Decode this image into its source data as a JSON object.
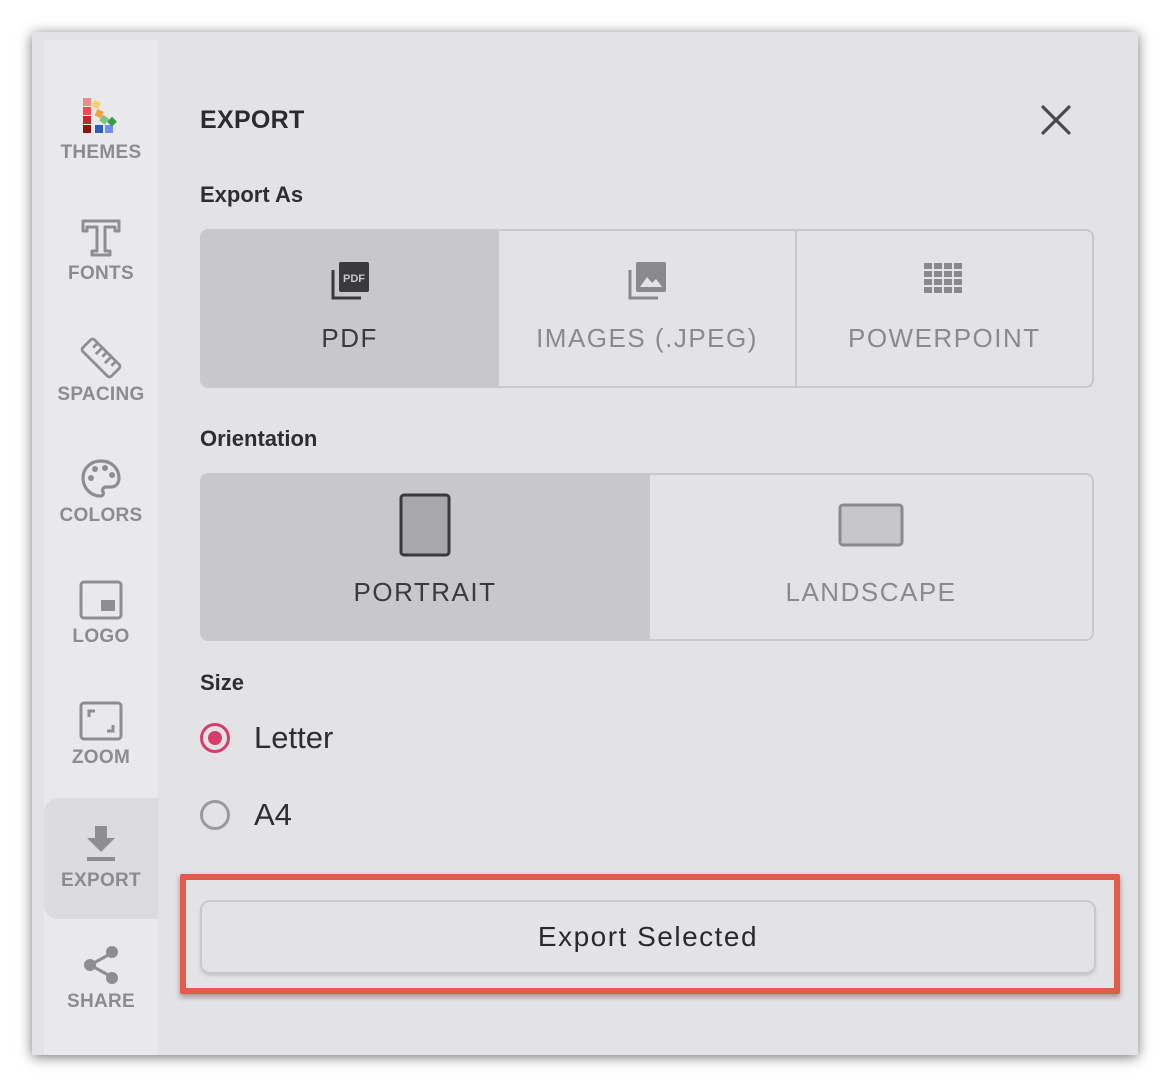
{
  "sidebar": {
    "items": [
      {
        "label": "THEMES",
        "icon": "palette-swatches-icon"
      },
      {
        "label": "FONTS",
        "icon": "font-t-icon"
      },
      {
        "label": "SPACING",
        "icon": "ruler-icon"
      },
      {
        "label": "COLORS",
        "icon": "paint-palette-icon"
      },
      {
        "label": "LOGO",
        "icon": "logo-frame-icon"
      },
      {
        "label": "ZOOM",
        "icon": "zoom-frame-icon"
      },
      {
        "label": "EXPORT",
        "icon": "download-icon",
        "active": true
      },
      {
        "label": "SHARE",
        "icon": "share-icon"
      }
    ]
  },
  "panel": {
    "title": "EXPORT",
    "export_as": {
      "label": "Export As",
      "options": [
        {
          "label": "PDF",
          "icon": "pdf-file-icon",
          "selected": true
        },
        {
          "label": "IMAGES (.JPEG)",
          "icon": "image-stack-icon",
          "selected": false
        },
        {
          "label": "POWERPOINT",
          "icon": "grid-icon",
          "selected": false
        }
      ]
    },
    "orientation": {
      "label": "Orientation",
      "options": [
        {
          "label": "PORTRAIT",
          "icon": "portrait-page-icon",
          "selected": true
        },
        {
          "label": "LANDSCAPE",
          "icon": "landscape-page-icon",
          "selected": false
        }
      ]
    },
    "size": {
      "label": "Size",
      "options": [
        {
          "label": "Letter",
          "selected": true
        },
        {
          "label": "A4",
          "selected": false
        }
      ]
    },
    "export_button": "Export Selected"
  },
  "colors": {
    "accent_radio": "#d63c6c",
    "highlight_border": "#e55a4a",
    "selected_bg": "#c8c8ca"
  }
}
